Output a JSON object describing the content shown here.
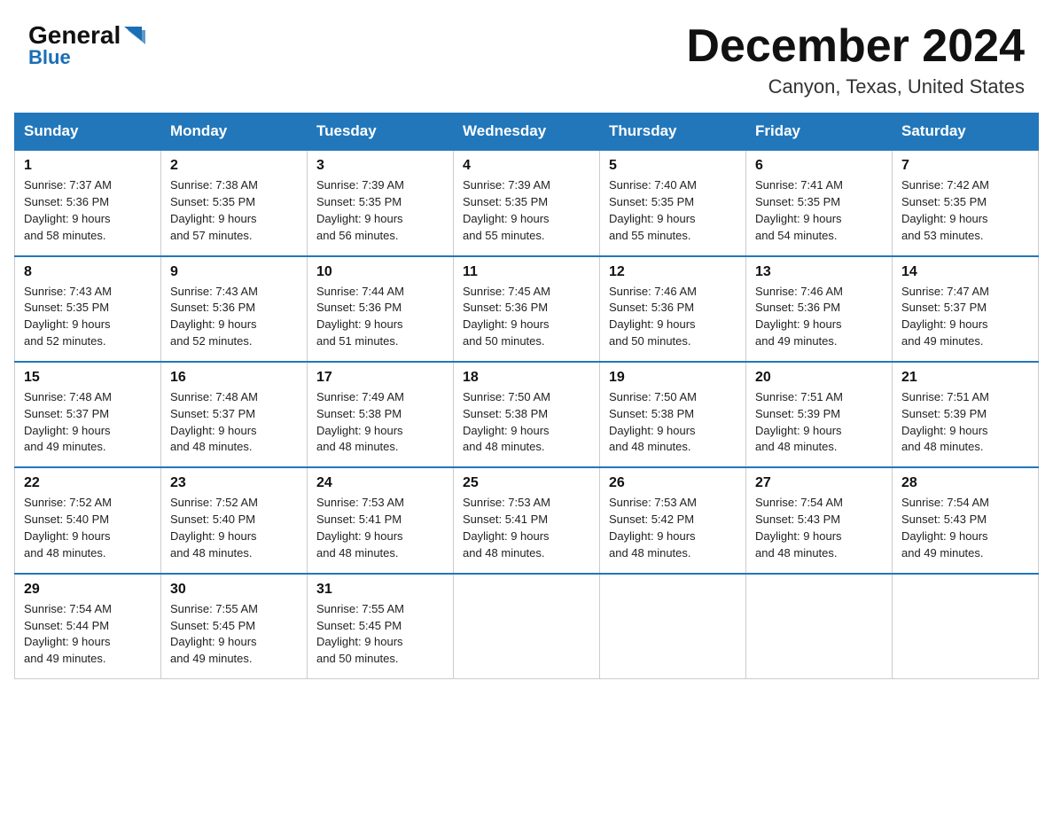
{
  "header": {
    "logo_general": "General",
    "logo_blue": "Blue",
    "title": "December 2024",
    "subtitle": "Canyon, Texas, United States"
  },
  "days_of_week": [
    "Sunday",
    "Monday",
    "Tuesday",
    "Wednesday",
    "Thursday",
    "Friday",
    "Saturday"
  ],
  "weeks": [
    [
      {
        "num": "1",
        "sunrise": "7:37 AM",
        "sunset": "5:36 PM",
        "daylight": "9 hours and 58 minutes."
      },
      {
        "num": "2",
        "sunrise": "7:38 AM",
        "sunset": "5:35 PM",
        "daylight": "9 hours and 57 minutes."
      },
      {
        "num": "3",
        "sunrise": "7:39 AM",
        "sunset": "5:35 PM",
        "daylight": "9 hours and 56 minutes."
      },
      {
        "num": "4",
        "sunrise": "7:39 AM",
        "sunset": "5:35 PM",
        "daylight": "9 hours and 55 minutes."
      },
      {
        "num": "5",
        "sunrise": "7:40 AM",
        "sunset": "5:35 PM",
        "daylight": "9 hours and 55 minutes."
      },
      {
        "num": "6",
        "sunrise": "7:41 AM",
        "sunset": "5:35 PM",
        "daylight": "9 hours and 54 minutes."
      },
      {
        "num": "7",
        "sunrise": "7:42 AM",
        "sunset": "5:35 PM",
        "daylight": "9 hours and 53 minutes."
      }
    ],
    [
      {
        "num": "8",
        "sunrise": "7:43 AM",
        "sunset": "5:35 PM",
        "daylight": "9 hours and 52 minutes."
      },
      {
        "num": "9",
        "sunrise": "7:43 AM",
        "sunset": "5:36 PM",
        "daylight": "9 hours and 52 minutes."
      },
      {
        "num": "10",
        "sunrise": "7:44 AM",
        "sunset": "5:36 PM",
        "daylight": "9 hours and 51 minutes."
      },
      {
        "num": "11",
        "sunrise": "7:45 AM",
        "sunset": "5:36 PM",
        "daylight": "9 hours and 50 minutes."
      },
      {
        "num": "12",
        "sunrise": "7:46 AM",
        "sunset": "5:36 PM",
        "daylight": "9 hours and 50 minutes."
      },
      {
        "num": "13",
        "sunrise": "7:46 AM",
        "sunset": "5:36 PM",
        "daylight": "9 hours and 49 minutes."
      },
      {
        "num": "14",
        "sunrise": "7:47 AM",
        "sunset": "5:37 PM",
        "daylight": "9 hours and 49 minutes."
      }
    ],
    [
      {
        "num": "15",
        "sunrise": "7:48 AM",
        "sunset": "5:37 PM",
        "daylight": "9 hours and 49 minutes."
      },
      {
        "num": "16",
        "sunrise": "7:48 AM",
        "sunset": "5:37 PM",
        "daylight": "9 hours and 48 minutes."
      },
      {
        "num": "17",
        "sunrise": "7:49 AM",
        "sunset": "5:38 PM",
        "daylight": "9 hours and 48 minutes."
      },
      {
        "num": "18",
        "sunrise": "7:50 AM",
        "sunset": "5:38 PM",
        "daylight": "9 hours and 48 minutes."
      },
      {
        "num": "19",
        "sunrise": "7:50 AM",
        "sunset": "5:38 PM",
        "daylight": "9 hours and 48 minutes."
      },
      {
        "num": "20",
        "sunrise": "7:51 AM",
        "sunset": "5:39 PM",
        "daylight": "9 hours and 48 minutes."
      },
      {
        "num": "21",
        "sunrise": "7:51 AM",
        "sunset": "5:39 PM",
        "daylight": "9 hours and 48 minutes."
      }
    ],
    [
      {
        "num": "22",
        "sunrise": "7:52 AM",
        "sunset": "5:40 PM",
        "daylight": "9 hours and 48 minutes."
      },
      {
        "num": "23",
        "sunrise": "7:52 AM",
        "sunset": "5:40 PM",
        "daylight": "9 hours and 48 minutes."
      },
      {
        "num": "24",
        "sunrise": "7:53 AM",
        "sunset": "5:41 PM",
        "daylight": "9 hours and 48 minutes."
      },
      {
        "num": "25",
        "sunrise": "7:53 AM",
        "sunset": "5:41 PM",
        "daylight": "9 hours and 48 minutes."
      },
      {
        "num": "26",
        "sunrise": "7:53 AM",
        "sunset": "5:42 PM",
        "daylight": "9 hours and 48 minutes."
      },
      {
        "num": "27",
        "sunrise": "7:54 AM",
        "sunset": "5:43 PM",
        "daylight": "9 hours and 48 minutes."
      },
      {
        "num": "28",
        "sunrise": "7:54 AM",
        "sunset": "5:43 PM",
        "daylight": "9 hours and 49 minutes."
      }
    ],
    [
      {
        "num": "29",
        "sunrise": "7:54 AM",
        "sunset": "5:44 PM",
        "daylight": "9 hours and 49 minutes."
      },
      {
        "num": "30",
        "sunrise": "7:55 AM",
        "sunset": "5:45 PM",
        "daylight": "9 hours and 49 minutes."
      },
      {
        "num": "31",
        "sunrise": "7:55 AM",
        "sunset": "5:45 PM",
        "daylight": "9 hours and 50 minutes."
      },
      null,
      null,
      null,
      null
    ]
  ],
  "labels": {
    "sunrise": "Sunrise:",
    "sunset": "Sunset:",
    "daylight": "Daylight:"
  }
}
